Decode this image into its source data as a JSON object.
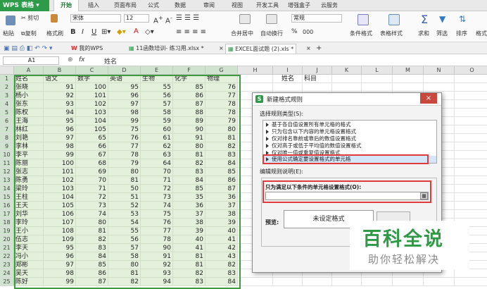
{
  "app": {
    "name": "WPS 表格",
    "tabs": [
      "开始",
      "插入",
      "页面布局",
      "公式",
      "数据",
      "审阅",
      "视图",
      "开发工具",
      "增强盒子",
      "云服务"
    ]
  },
  "ribbon": {
    "paste": "粘贴",
    "cut": "剪切",
    "copy": "复制",
    "format_painter": "格式刷",
    "font_name": "宋体",
    "font_size": "12",
    "font_buttons": [
      "B",
      "I",
      "U",
      "A",
      "A"
    ],
    "merge": "合并居中",
    "wrap": "自动换行",
    "number_format": "常规",
    "percent": "%",
    "thousands": "000",
    "cond_format": "条件格式",
    "table_style": "表格样式",
    "sum": "求和",
    "filter": "筛选",
    "sort": "排序",
    "format": "格式"
  },
  "docs": {
    "tabs": [
      "我的WPS",
      "11函数培训- 练习用.xlsx *",
      "EXCEL面试题 (2).xls *"
    ],
    "new_tab": "+",
    "close": "×"
  },
  "formula": {
    "cell_ref": "A1",
    "fx": "fx",
    "value": "姓名"
  },
  "sheet": {
    "columns": [
      "A",
      "B",
      "C",
      "D",
      "E",
      "F",
      "G",
      "H",
      "I",
      "J",
      "K",
      "L",
      "M",
      "N",
      "O"
    ],
    "headers": [
      "姓名",
      "语文",
      "数学",
      "英语",
      "生物",
      "化学",
      "物理"
    ],
    "rows": [
      [
        "张晓",
        "91",
        "100",
        "95",
        "55",
        "85",
        "76"
      ],
      [
        "杨小",
        "92",
        "101",
        "96",
        "56",
        "86",
        "77"
      ],
      [
        "张东",
        "93",
        "102",
        "97",
        "57",
        "87",
        "78"
      ],
      [
        "陈权",
        "94",
        "103",
        "98",
        "58",
        "88",
        "78"
      ],
      [
        "王海",
        "95",
        "104",
        "99",
        "59",
        "89",
        "79"
      ],
      [
        "林红",
        "96",
        "105",
        "75",
        "60",
        "90",
        "80"
      ],
      [
        "刘艳",
        "97",
        "65",
        "76",
        "61",
        "91",
        "81"
      ],
      [
        "李林",
        "98",
        "66",
        "77",
        "62",
        "80",
        "82"
      ],
      [
        "李平",
        "99",
        "67",
        "78",
        "63",
        "81",
        "83"
      ],
      [
        "陈丽",
        "100",
        "68",
        "79",
        "64",
        "82",
        "84"
      ],
      [
        "张志",
        "101",
        "69",
        "80",
        "70",
        "83",
        "85"
      ],
      [
        "陈勇",
        "102",
        "70",
        "81",
        "71",
        "84",
        "86"
      ],
      [
        "梁玲",
        "103",
        "71",
        "50",
        "72",
        "85",
        "87"
      ],
      [
        "王柱",
        "104",
        "72",
        "51",
        "73",
        "35",
        "36"
      ],
      [
        "王天",
        "105",
        "73",
        "52",
        "74",
        "36",
        "37"
      ],
      [
        "刘华",
        "106",
        "74",
        "53",
        "75",
        "37",
        "38"
      ],
      [
        "李玲",
        "107",
        "80",
        "54",
        "76",
        "38",
        "39"
      ],
      [
        "王小",
        "108",
        "81",
        "55",
        "77",
        "39",
        "40"
      ],
      [
        "伍志",
        "109",
        "82",
        "56",
        "78",
        "40",
        "41"
      ],
      [
        "李天",
        "95",
        "83",
        "57",
        "90",
        "41",
        "42"
      ],
      [
        "冯小",
        "96",
        "84",
        "58",
        "91",
        "81",
        "43"
      ],
      [
        "郑彬",
        "97",
        "85",
        "80",
        "92",
        "81",
        "82"
      ],
      [
        "吴天",
        "98",
        "86",
        "81",
        "93",
        "82",
        "83"
      ],
      [
        "陈好",
        "99",
        "87",
        "82",
        "94",
        "83",
        "84"
      ]
    ],
    "side_labels": [
      "姓名",
      "科目"
    ]
  },
  "dialog": {
    "title": "新建格式规则",
    "rule_type_label": "选择规则类型(S):",
    "rule_types": [
      "基于各自值设置所有单元格的格式",
      "只为包含以下内容的单元格设置格式",
      "仅对排名靠前或靠后的数值设置格式",
      "仅对高于或低于平均值的数值设置格式",
      "仅对唯一值或重复值设置格式",
      "使用公式确定要设置格式的单元格"
    ],
    "desc_label": "编辑规则说明(E):",
    "formula_label": "只为满足以下条件的单元格设置格式(O):",
    "preview_label": "预览:",
    "preview_text": "未设定格式",
    "close": "×"
  },
  "watermark": {
    "title": "百科全说",
    "subtitle": "助你轻松解决"
  },
  "colors": {
    "wps_green": "#2e9b49",
    "selection_green": "#e3f1dc",
    "highlight_red": "#e03a3a",
    "watermark_green": "#2f9a46"
  }
}
